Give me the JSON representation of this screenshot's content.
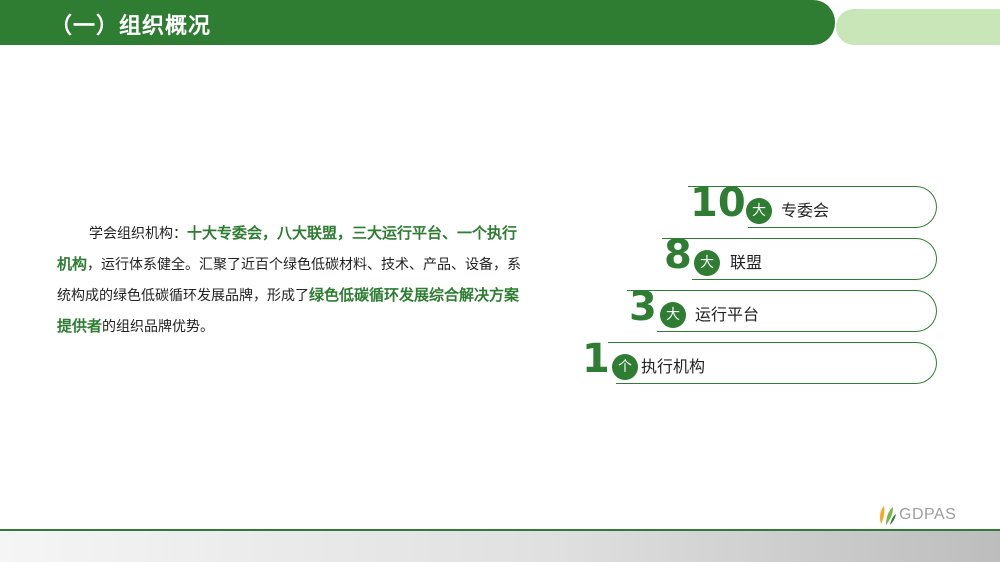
{
  "header": {
    "title": "（一）组织概况"
  },
  "intro": {
    "prefix": "学会组织机构：",
    "highlight1": "十大专委会，八大联盟，三大运行平台、一个执行机构",
    "middle": "，运行体系健全。汇聚了近百个绿色低碳材料、技术、产品、设备，系统构成的绿色低碳循环发展品牌，形成了",
    "highlight2": "绿色低碳循环发展综合解决方案提供者",
    "suffix": "的组织品牌优势。"
  },
  "stats": [
    {
      "number": "10",
      "unit": "大",
      "label": "专委会"
    },
    {
      "number": "8",
      "unit": "大",
      "label": "联盟"
    },
    {
      "number": "3",
      "unit": "大",
      "label": "运行平台"
    },
    {
      "number": "1",
      "unit": "个",
      "label": "执行机构"
    }
  ],
  "footer": {
    "logo_text": "GDPAS",
    "logo_icon": "leaf-logo-icon"
  },
  "colors": {
    "primary": "#2e7d32",
    "accent_light": "#c8e6b8"
  }
}
